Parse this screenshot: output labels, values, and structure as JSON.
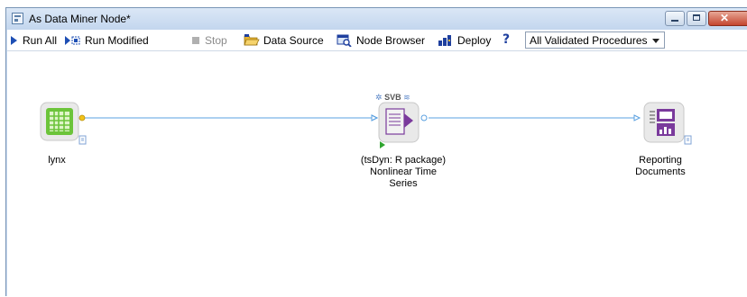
{
  "window": {
    "title": "As Data Miner Node*"
  },
  "toolbar": {
    "run_all": "Run All",
    "run_modified": "Run Modified",
    "stop": "Stop",
    "data_source": "Data Source",
    "node_browser": "Node Browser",
    "deploy": "Deploy",
    "help": "?",
    "procedure_filter": {
      "selected": "All Validated Procedures"
    }
  },
  "colors": {
    "connection_line": "#5aa0e0",
    "data_node_green": "#6cc43a",
    "analysis_node_purple": "#7a3a9c",
    "run_arrow_blue": "#1e4fb4"
  },
  "nodes": [
    {
      "id": "lynx",
      "label": "lynx",
      "icon": "data-table-icon"
    },
    {
      "id": "tsdyn",
      "badge": "SVB",
      "label_lines": [
        "(tsDyn: R package)",
        "Nonlinear Time",
        "Series"
      ],
      "icon": "analysis-node-icon"
    },
    {
      "id": "reporting",
      "label_lines": [
        "Reporting",
        "Documents"
      ],
      "icon": "reporting-documents-icon"
    }
  ]
}
